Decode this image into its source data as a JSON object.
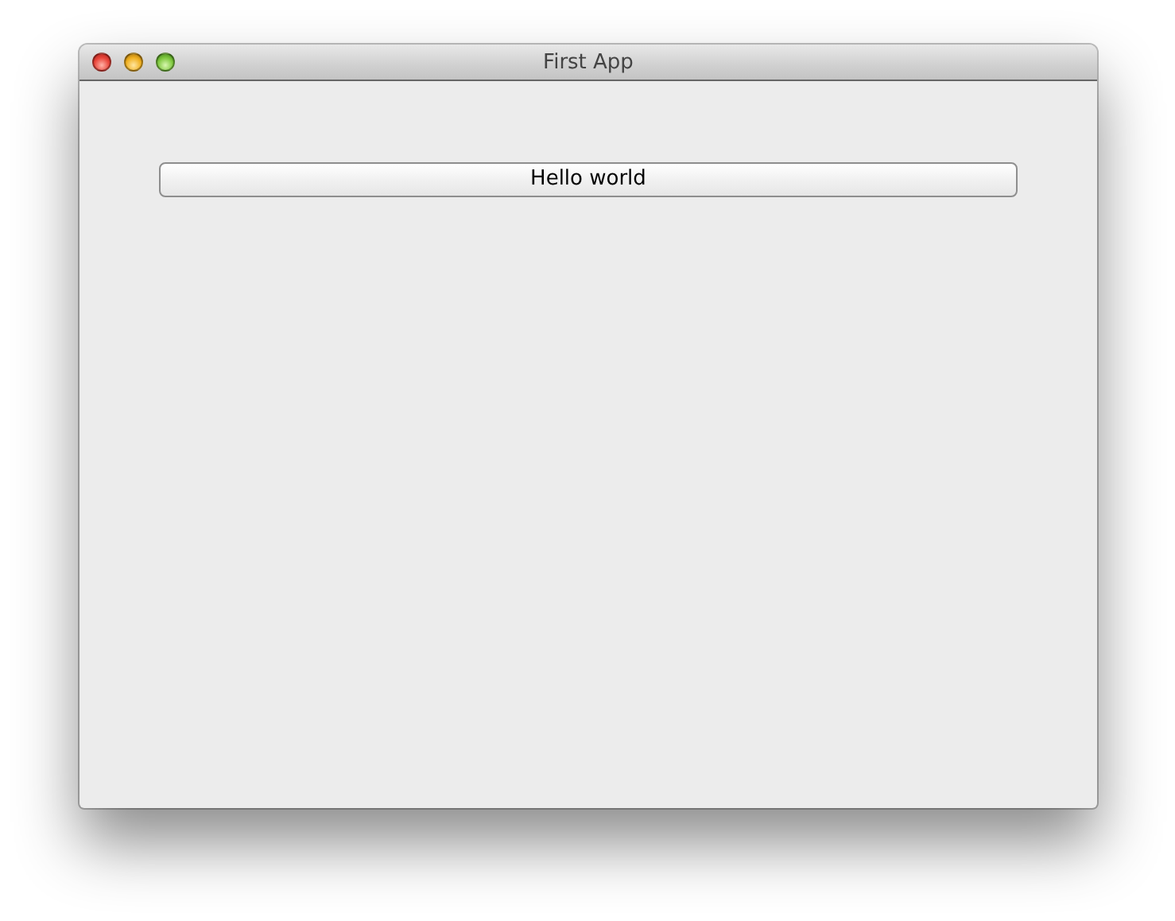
{
  "window": {
    "title": "First App"
  },
  "buttons": [
    {
      "label": "Hello world"
    }
  ]
}
